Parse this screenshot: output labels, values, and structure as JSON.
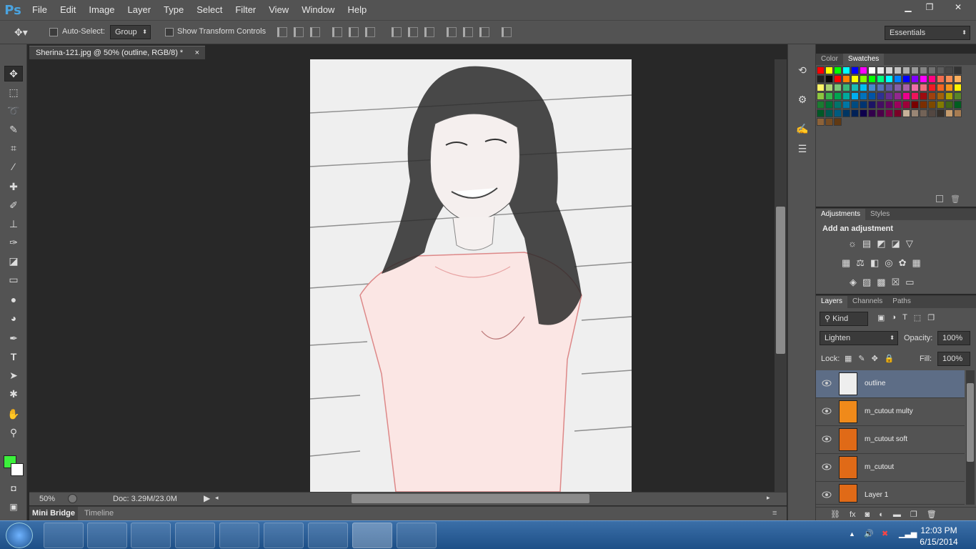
{
  "app": {
    "logo": "Ps"
  },
  "menubar": {
    "items": [
      "File",
      "Edit",
      "Image",
      "Layer",
      "Type",
      "Select",
      "Filter",
      "View",
      "Window",
      "Help"
    ]
  },
  "window_controls": {
    "minimize": "▁",
    "restore": "❐",
    "close": "✕"
  },
  "options": {
    "auto_select_label": "Auto-Select:",
    "auto_select_value": "Group",
    "show_transform_label": "Show Transform Controls",
    "workspace": "Essentials"
  },
  "document": {
    "tab_title": "Sherina-121.jpg @ 50% (outline, RGB/8) *",
    "tab_close": "×",
    "zoom": "50%",
    "doc_size": "Doc: 3.29M/23.0M"
  },
  "bottom_tabs": [
    "Mini Bridge",
    "Timeline"
  ],
  "color_panel": {
    "tabs": [
      "Color",
      "Swatches"
    ],
    "active": "Swatches"
  },
  "swatch_colors": [
    "#ff0000",
    "#ffff00",
    "#00ff00",
    "#00ffff",
    "#0000ff",
    "#ff00ff",
    "#ffffff",
    "#ebebeb",
    "#d6d6d6",
    "#c2c2c2",
    "#adadad",
    "#999999",
    "#858585",
    "#707070",
    "#5c5c5c",
    "#474747",
    "#333333",
    "#1f1f1f",
    "#0a0a0a",
    "#ff0000",
    "#ff8000",
    "#ffff00",
    "#80ff00",
    "#00ff00",
    "#00ff80",
    "#00ffff",
    "#0080ff",
    "#0000ff",
    "#8000ff",
    "#ff00ff",
    "#ff0080",
    "#f26c4f",
    "#f68e55",
    "#fbaf5d",
    "#fff467",
    "#acd372",
    "#7cc576",
    "#3bb878",
    "#1abbb4",
    "#00bff3",
    "#438ccb",
    "#5574b9",
    "#605ca8",
    "#855fa8",
    "#a763a8",
    "#f06ea9",
    "#f26d7d",
    "#ed1c24",
    "#f26522",
    "#f7941d",
    "#fff200",
    "#8dc63f",
    "#39b54a",
    "#00a651",
    "#00a99d",
    "#00aeef",
    "#0072bc",
    "#0054a6",
    "#2e3192",
    "#662d91",
    "#92278f",
    "#ec008c",
    "#ed145b",
    "#9e0b0f",
    "#a0410d",
    "#a3620a",
    "#aba000",
    "#598527",
    "#1a7b30",
    "#007236",
    "#00746b",
    "#0076a3",
    "#004b80",
    "#003471",
    "#1b1464",
    "#440e62",
    "#630460",
    "#9e005d",
    "#9e0039",
    "#790000",
    "#7b2e00",
    "#7d4900",
    "#827b00",
    "#406618",
    "#005e20",
    "#005826",
    "#005952",
    "#005b7f",
    "#003663",
    "#002157",
    "#0d004c",
    "#32004b",
    "#4b0049",
    "#7b0046",
    "#7a0026",
    "#c7b299",
    "#998675",
    "#736357",
    "#534741",
    "#37302a",
    "#c69c6d",
    "#a67c52",
    "#8c6239",
    "#754c24",
    "#603913"
  ],
  "adjustments": {
    "tabs": [
      "Adjustments",
      "Styles"
    ],
    "heading": "Add an adjustment"
  },
  "layers_panel": {
    "tabs": [
      "Layers",
      "Channels",
      "Paths"
    ],
    "filter_kind": "Kind",
    "blend_mode": "Lighten",
    "opacity_label": "Opacity:",
    "opacity_value": "100%",
    "lock_label": "Lock:",
    "fill_label": "Fill:",
    "fill_value": "100%",
    "layers": [
      "outline",
      "m_cutout multy",
      "m_cutout soft",
      "m_cutout",
      "Layer 1"
    ]
  },
  "clock": {
    "time": "12:03 PM",
    "date": "6/15/2014"
  }
}
